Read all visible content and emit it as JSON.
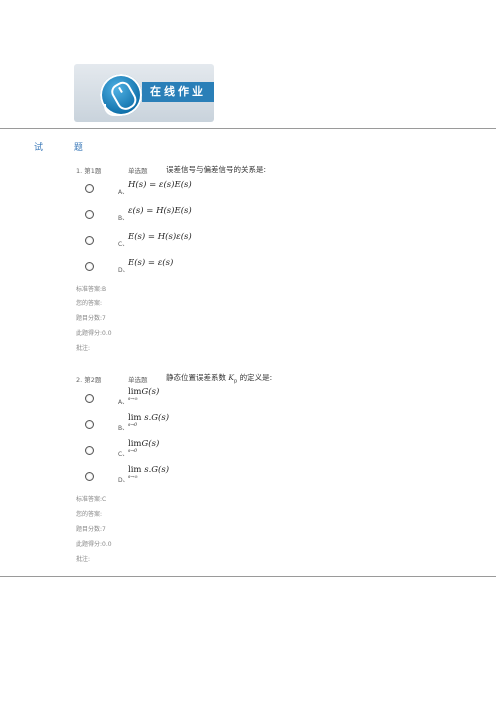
{
  "banner": {
    "title": "在线作业"
  },
  "section_title": "试 题",
  "questions": [
    {
      "number": "1. 第1题",
      "type": "单选题",
      "text": "误差信号与偏差信号的关系是:",
      "options": [
        {
          "letter": "A、",
          "formula": "H(s) = ε(s)E(s)"
        },
        {
          "letter": "B、",
          "formula": "ε(s) = H(s)E(s)"
        },
        {
          "letter": "C、",
          "formula": "E(s) = H(s)ε(s)"
        },
        {
          "letter": "D、",
          "formula": "E(s) = ε(s)"
        }
      ],
      "meta": [
        "标准答案:B",
        "您的答案:",
        "题目分数:7",
        "此题得分:0.0",
        "批注:"
      ]
    },
    {
      "number": "2. 第2题",
      "type": "单选题",
      "text_prefix": "静态位置误差系数 ",
      "text_var": "K",
      "text_sub": "p",
      "text_suffix": " 的定义是:",
      "options": [
        {
          "letter": "A、",
          "lim": "lim",
          "sub": "s→∞",
          "rest": "G(s)"
        },
        {
          "letter": "B、",
          "lim": "lim",
          "sub": "s→0",
          "rest": " s.G(s)"
        },
        {
          "letter": "C、",
          "lim": "lim",
          "sub": "s→0",
          "rest": "G(s)"
        },
        {
          "letter": "D、",
          "lim": "lim",
          "sub": "s→∞",
          "rest": " s.G(s)"
        }
      ],
      "meta": [
        "标准答案:C",
        "您的答案:",
        "题目分数:7",
        "此题得分:0.0",
        "批注:"
      ]
    }
  ]
}
